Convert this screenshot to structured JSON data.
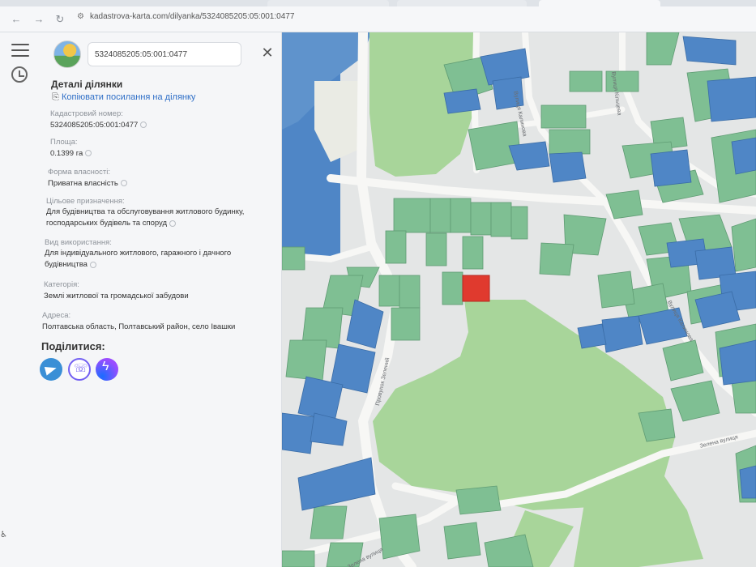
{
  "browser": {
    "url": "kadastrova-karta.com/dilyanka/5324085205:05:001:0477",
    "tabs": [
      "",
      "",
      ""
    ]
  },
  "search": {
    "value": "5324085205:05:001:0477"
  },
  "details": {
    "title": "Деталі ділянки",
    "copy_link": "Копіювати посилання на ділянку",
    "fields": [
      {
        "label": "Кадастровий номер:",
        "value": "5324085205:05:001:0477"
      },
      {
        "label": "Площа:",
        "value": "0.1399 га"
      },
      {
        "label": "Форма власності:",
        "value": "Приватна власність"
      },
      {
        "label": "Цільове призначення:",
        "value": "Для будівництва та обслуговування житлового будинку, господарських будівель та споруд"
      },
      {
        "label": "Вид використання:",
        "value": "Для індивідуального житлового, гаражного і дачного будівництва"
      },
      {
        "label": "Категорія:",
        "value": "Землі житлової та громадської забудови"
      },
      {
        "label": "Адреса:",
        "value": "Полтавська область, Полтавський район, село Івашки"
      }
    ]
  },
  "share": {
    "title": "Поділитися:"
  },
  "map": {
    "streets": [
      "Вулиця Калинова",
      "Вулиця Кільцева",
      "Вулиця Калинова",
      "Провулок Зелений",
      "Зелена вулиця",
      "Зелена вулиця"
    ],
    "colors": {
      "green_parcel": "#7fbf93",
      "blue_parcel": "#4f86c6",
      "forest": "#a8d59a",
      "water": "#4f86c6",
      "road": "#f7f7f5",
      "selected": "#e03a2e"
    }
  }
}
